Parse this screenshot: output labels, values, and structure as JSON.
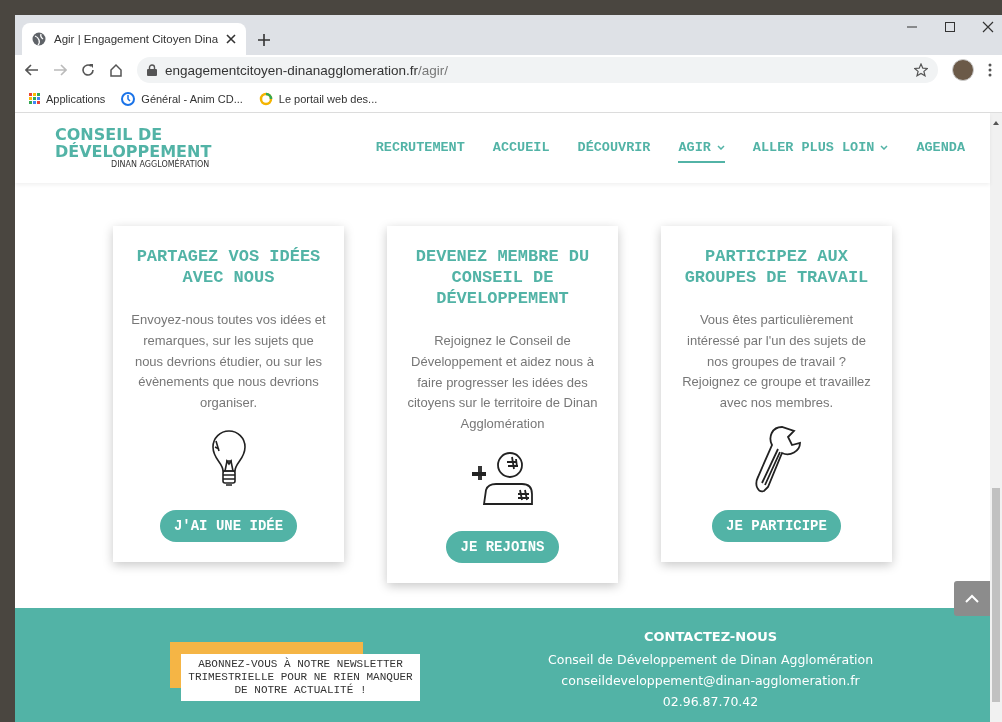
{
  "browser": {
    "tab_title": "Agir | Engagement Citoyen Dina",
    "url_domain": "engagementcitoyen-dinanagglomeration.fr",
    "url_path": "/agir/",
    "bookmarks": [
      {
        "kind": "apps",
        "label": "Applications"
      },
      {
        "kind": "clock",
        "label": "Général - Anim CD..."
      },
      {
        "kind": "ring",
        "label": "Le portail web des..."
      }
    ]
  },
  "header": {
    "logo": {
      "line_1": "CONSEIL DE",
      "line_2": "DÉVELOPPEMENT",
      "line_3": "DINAN AGGLOMÉRATION"
    },
    "nav": [
      {
        "label": "RECRUTEMENT",
        "selected": false,
        "dropdown": false
      },
      {
        "label": "ACCUEIL",
        "selected": false,
        "dropdown": false
      },
      {
        "label": "DÉCOUVRIR",
        "selected": false,
        "dropdown": false
      },
      {
        "label": "AGIR",
        "selected": true,
        "dropdown": true
      },
      {
        "label": "ALLER PLUS LOIN",
        "selected": false,
        "dropdown": true
      },
      {
        "label": "AGENDA",
        "selected": false,
        "dropdown": false
      }
    ]
  },
  "cards": [
    {
      "title": "PARTAGEZ VOS IDÉES AVEC NOUS",
      "text": "Envoyez-nous toutes vos idées et remarques, sur les sujets que nous devrions étudier, ou sur les évènements que nous devrions organiser.",
      "button": "J'AI UNE IDÉE"
    },
    {
      "title": "DEVENEZ MEMBRE DU CONSEIL DE DÉVELOPPEMENT",
      "text": "Rejoignez le Conseil de Développement et aidez nous à faire progresser les idées des citoyens sur le territoire de Dinan Agglomération",
      "button": "JE REJOINS"
    },
    {
      "title": "PARTICIPEZ AUX GROUPES DE TRAVAIL",
      "text": "Vous êtes particulièrement intéressé par l'un des sujets de nos groupes de travail ? Rejoignez ce groupe et travaillez avec nos membres.",
      "button": "JE PARTICIPE"
    }
  ],
  "footer": {
    "newsletter": "ABONNEZ-VOUS À NOTRE NEWSLETTER TRIMESTRIELLE POUR NE RIEN MANQUER DE NOTRE ACTUALITÉ !",
    "contact_title": "CONTACTEZ-NOUS",
    "contact_lines": [
      "Conseil de Développement de Dinan Agglomération",
      "conseildeveloppement@dinan-agglomeration.fr",
      "02.96.87.70.42"
    ]
  }
}
